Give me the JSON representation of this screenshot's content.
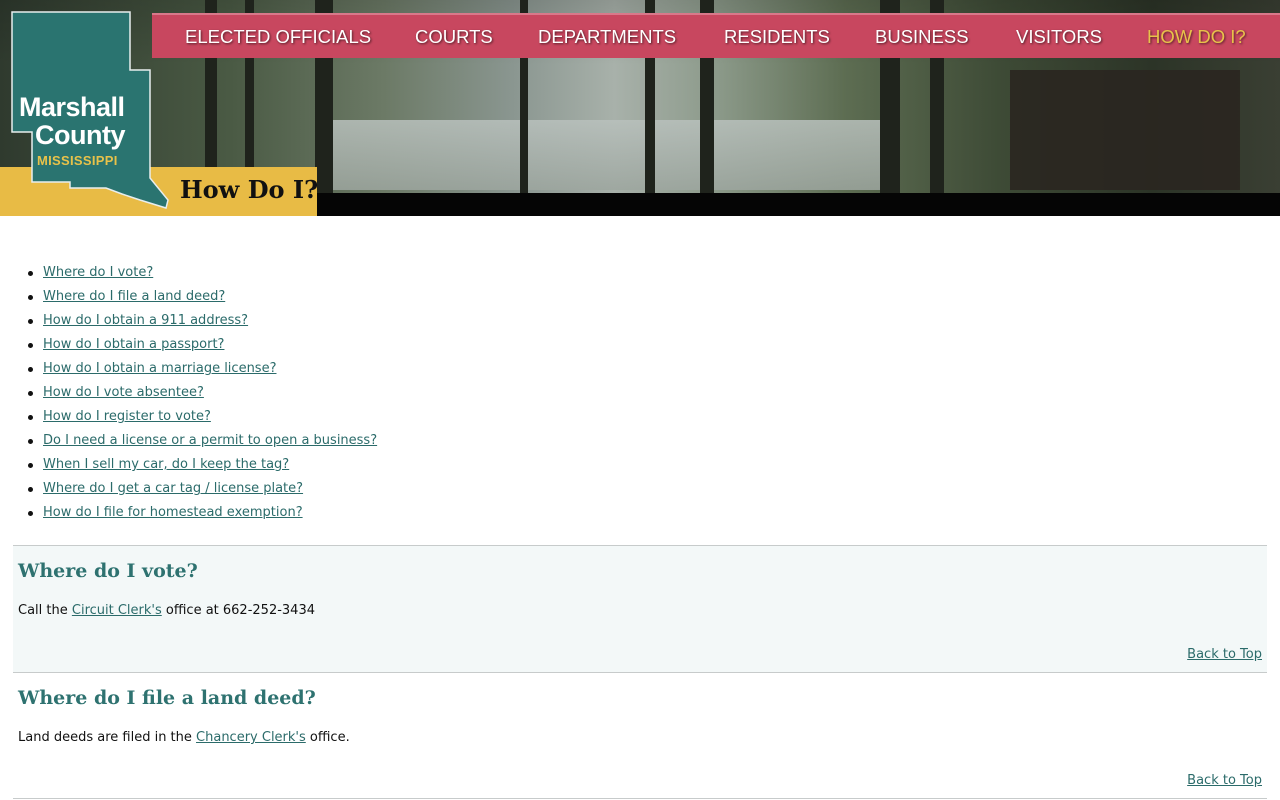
{
  "brand": {
    "line1": "Marshall",
    "line2": "County",
    "line3": "MISSISSIPPI",
    "colors": {
      "teal": "#2a7470",
      "gold": "#e8bb45",
      "nav": "#c8475f",
      "link": "#2b6b6a"
    }
  },
  "nav": {
    "items": [
      {
        "label": "ELECTED OFFICIALS"
      },
      {
        "label": "COURTS"
      },
      {
        "label": "DEPARTMENTS"
      },
      {
        "label": "RESIDENTS"
      },
      {
        "label": "BUSINESS"
      },
      {
        "label": "VISITORS"
      },
      {
        "label": "HOW DO I?",
        "active": true
      }
    ]
  },
  "page": {
    "title": "How Do I?"
  },
  "toc": [
    "Where do I vote?",
    "Where do I file a land deed?",
    "How do I obtain a 911 address?",
    "How do I obtain a passport?",
    "How do I obtain a marriage license?",
    "How do I vote absentee?",
    "How do I register to vote?",
    "Do I need a license or a permit to open a business?",
    "When I sell my car, do I keep the tag?",
    "Where do I get a car tag / license plate?",
    "How do I file for homestead exemption?"
  ],
  "sections": [
    {
      "heading": "Where do I vote?",
      "text_before": "Call the ",
      "link": "Circuit Clerk's",
      "text_after": " office at 662-252-3434",
      "back": "Back to Top"
    },
    {
      "heading": "Where do I file a land deed?",
      "text_before": "Land deeds are filed in the ",
      "link": "Chancery Clerk's",
      "text_after": " office.",
      "back": "Back to Top"
    }
  ]
}
